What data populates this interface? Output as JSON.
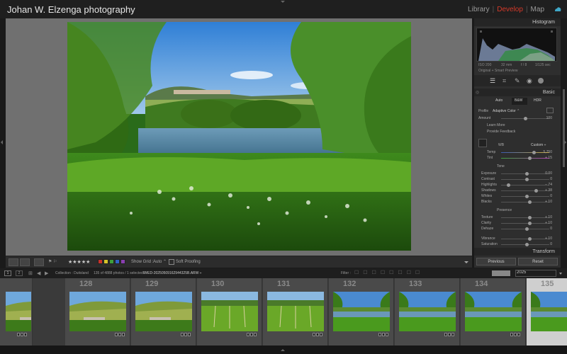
{
  "header": {
    "identity_plate": "Johan W. Elzenga photography",
    "modules": [
      "Library",
      "Develop",
      "Map"
    ],
    "active_module": "Develop"
  },
  "toolbar": {
    "stars": "★★★★★",
    "show_grid": "Show Grid :",
    "auto": "Auto ⌃",
    "soft_proofing": "Soft Proofing",
    "color_labels": [
      "#c8312b",
      "#d6c32a",
      "#3fa03b",
      "#3061c8",
      "#8a3fb0"
    ]
  },
  "right_panel": {
    "histogram_label": "Histogram",
    "exif": [
      "ISO 200",
      "32 mm",
      "f / 8",
      "1/125 sec"
    ],
    "original_preview": "Original + Smart Preview",
    "basic_label": "Basic",
    "treatment": [
      "Auto",
      "B&W",
      "HDR"
    ],
    "profile_label": "Profile",
    "profile_value": "Adaptive Color ⌃",
    "amount_label": "Amount",
    "amount_value": "100",
    "learn_more": "Learn More",
    "feedback": "Provide Feedback",
    "wb_label": "WB",
    "wb_value": "Custom ÷",
    "temp_label": "Temp",
    "temp_value": "5,750",
    "tint_label": "Tint",
    "tint_value": "+ 15",
    "tone_label": "Tone",
    "tone_rows": [
      {
        "label": "Exposure",
        "value": "0.00"
      },
      {
        "label": "Contrast",
        "value": "0"
      },
      {
        "label": "Highlights",
        "value": "− 74"
      },
      {
        "label": "Shadows",
        "value": "+ 38"
      },
      {
        "label": "Whites",
        "value": "0"
      },
      {
        "label": "Blacks",
        "value": "+ 10"
      }
    ],
    "presence_label": "Presence",
    "presence_rows": [
      {
        "label": "Texture",
        "value": "+ 10"
      },
      {
        "label": "Clarity",
        "value": "+ 10"
      },
      {
        "label": "Dehaze",
        "value": "0"
      },
      {
        "label": "Vibrance",
        "value": "+ 10"
      },
      {
        "label": "Saturation",
        "value": "0"
      }
    ],
    "transform_label": "Transform",
    "previous": "Previous",
    "reset": "Reset"
  },
  "filmstrip_header": {
    "pages": [
      "1",
      "2"
    ],
    "collection": "Collection : Duitsland",
    "count": "135 of 4888 photos / 1 selected /",
    "filename": "IWED-20250509162944325B.ARW ÷",
    "filter_label": "Filter :",
    "year": "2025"
  },
  "filmstrip": {
    "cells": [
      {
        "num": "",
        "kind": "vine"
      },
      {
        "num": "128",
        "kind": "vine"
      },
      {
        "num": "129",
        "kind": "vine"
      },
      {
        "num": "130",
        "kind": "vineyard"
      },
      {
        "num": "131",
        "kind": "vineyard"
      },
      {
        "num": "132",
        "kind": "river"
      },
      {
        "num": "133",
        "kind": "river"
      },
      {
        "num": "134",
        "kind": "river"
      },
      {
        "num": "135",
        "kind": "river"
      }
    ],
    "selected_index": 8
  }
}
